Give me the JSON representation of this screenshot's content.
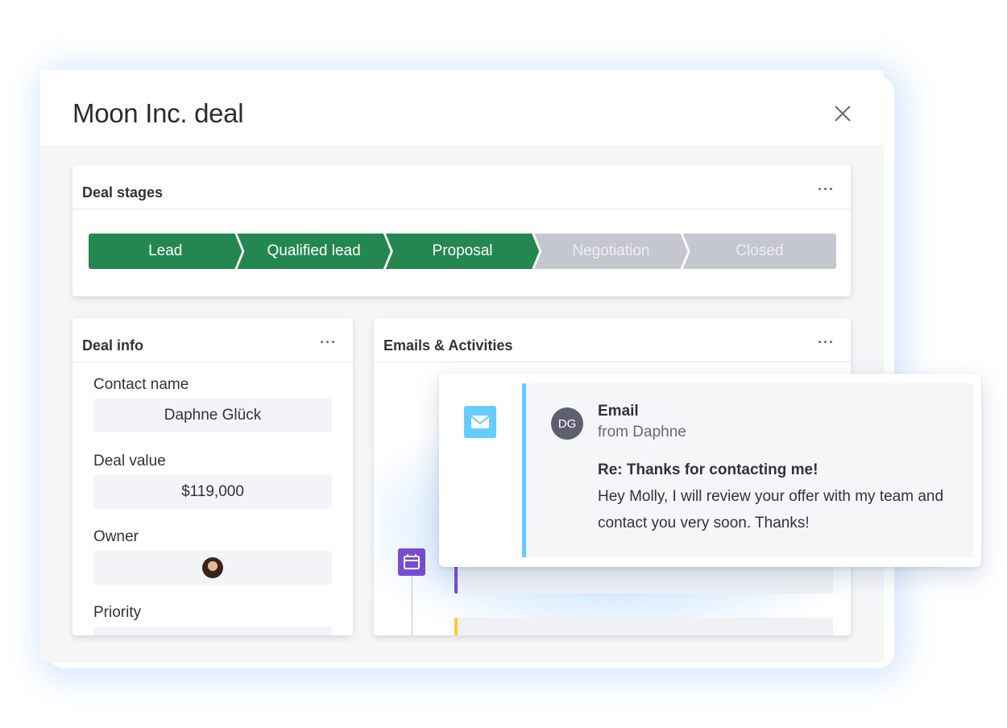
{
  "modal": {
    "title": "Moon Inc. deal",
    "close_icon": "close-icon"
  },
  "deal_stages": {
    "title": "Deal stages",
    "menu": "···",
    "stages": [
      {
        "label": "Lead",
        "status": "completed"
      },
      {
        "label": "Qualified lead",
        "status": "completed"
      },
      {
        "label": "Proposal",
        "status": "completed"
      },
      {
        "label": "Negotiation",
        "status": "pending"
      },
      {
        "label": "Closed",
        "status": "pending"
      }
    ],
    "colors": {
      "completed": "#258750",
      "pending": "#c5c7d0"
    }
  },
  "deal_info": {
    "title": "Deal info",
    "menu": "···",
    "fields": {
      "contact_name_label": "Contact name",
      "contact_name_value": "Daphne Glück",
      "deal_value_label": "Deal value",
      "deal_value_value": "$119,000",
      "owner_label": "Owner",
      "owner_avatar": "avatar-photo",
      "priority_label": "Priority"
    }
  },
  "activities": {
    "title": "Emails & Activities",
    "menu": "···",
    "calendar_icon": "calendar-icon",
    "accent_purple": "#784bd1",
    "accent_yellow": "#fdcb33"
  },
  "email_popup": {
    "icon": "mail-icon",
    "accent": "#66ccff",
    "avatar_initials": "DG",
    "type": "Email",
    "from": "from Daphne",
    "subject": "Re: Thanks for contacting me!",
    "body": "Hey Molly, I will review your offer with my team and contact you very soon. Thanks!"
  }
}
